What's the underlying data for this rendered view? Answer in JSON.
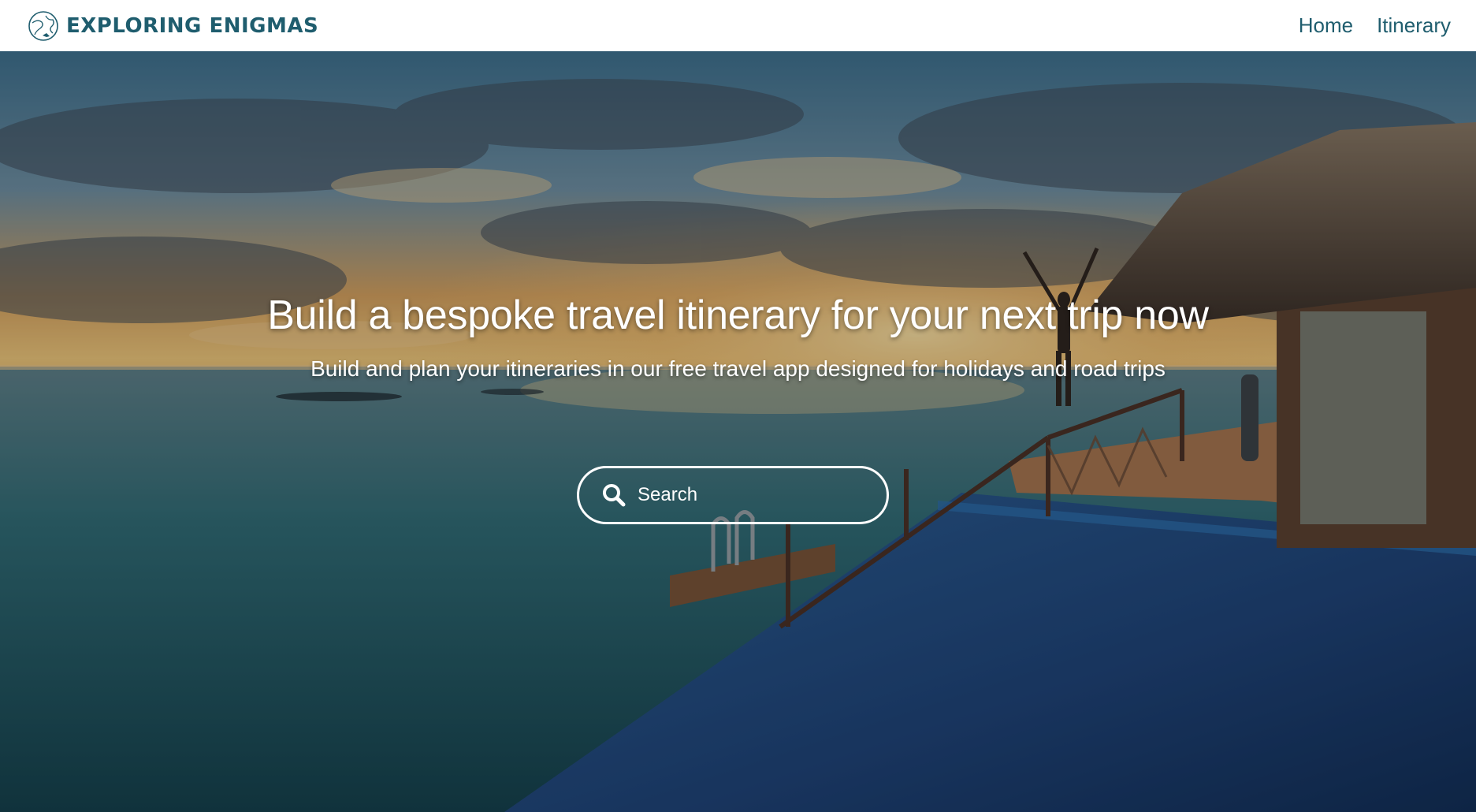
{
  "brand": {
    "name": "EXPLORING ENIGMAS",
    "logo_icon": "globe-plane-icon",
    "color": "#1f5d6e"
  },
  "nav": {
    "items": [
      {
        "label": "Home"
      },
      {
        "label": "Itinerary"
      }
    ]
  },
  "hero": {
    "title": "Build a bespoke travel itinerary for your next trip now",
    "subtitle": "Build and plan your itineraries in our free travel app designed for holidays and road trips",
    "background": "sunset-ocean-overwater-villa-photo"
  },
  "search": {
    "placeholder": "Search",
    "value": "",
    "icon": "search-icon"
  }
}
